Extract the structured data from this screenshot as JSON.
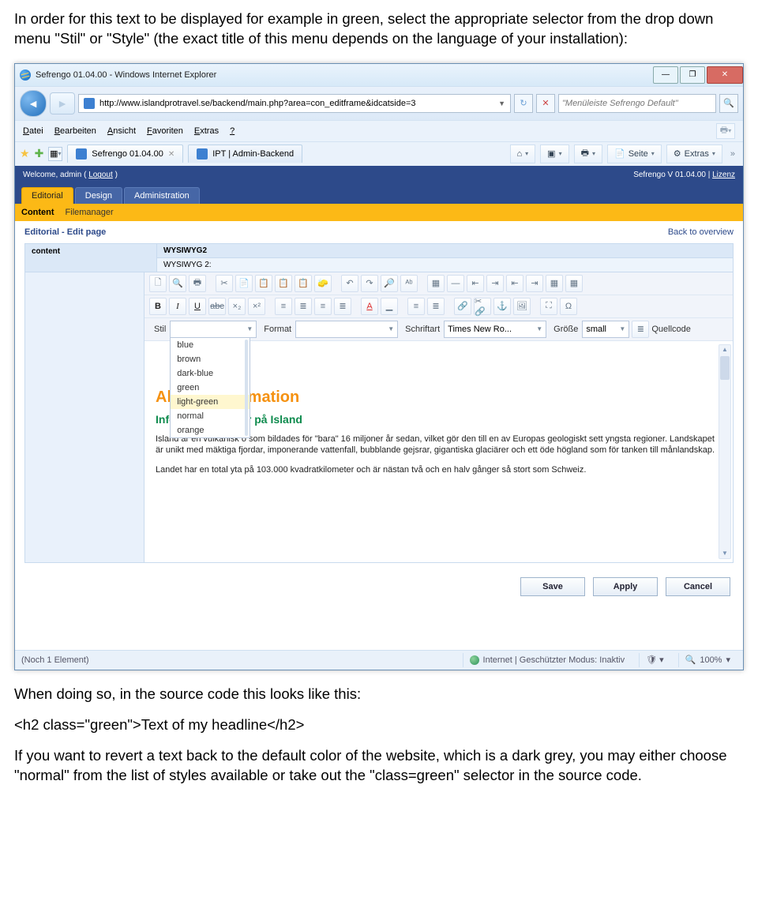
{
  "instructions": {
    "intro": "In order for this text to be displayed for example in green, select the appropriate selector from the drop down menu \"Stil\" or \"Style\" (the exact title of this menu depends on the language of your installation):",
    "source_lead": "When doing so, in the source code this looks like this:",
    "code_example": "<h2 class=\"green\">Text of my headline</h2>",
    "revert": "If you want to revert a text back to the default color of the website, which is a dark grey, you may either choose \"normal\" from the list of styles available or take out the \"class=green\" selector in the source code."
  },
  "browser": {
    "window_title": "Sefrengo 01.04.00 - Windows Internet Explorer",
    "url": "http://www.islandprotravel.se/backend/main.php?area=con_editframe&idcatside=3",
    "search_placeholder": "\"Menüleiste Sefrengo Default\"",
    "menus": [
      "Datei",
      "Bearbeiten",
      "Ansicht",
      "Favoriten",
      "Extras",
      "?"
    ],
    "tabs": [
      {
        "label": "Sefrengo 01.04.00"
      },
      {
        "label": "IPT | Admin-Backend"
      }
    ],
    "righttools": {
      "seite": "Seite",
      "extras": "Extras",
      "chevrons": "»"
    },
    "status": {
      "left": "(Noch 1 Element)",
      "mid": "Internet | Geschützter Modus: Inaktiv",
      "zoom": "100%"
    }
  },
  "app": {
    "welcome": "Welcome, admin (",
    "logout": "Logout",
    "welcome_tail": " )",
    "version": "Sefrengo V 01.04.00 |",
    "license": "Lizenz",
    "main_tabs": [
      "Editorial",
      "Design",
      "Administration"
    ],
    "sub_tabs": [
      "Content",
      "Filemanager"
    ],
    "breadcrumb": "Editorial - Edit page",
    "back": "Back to overview",
    "left_label": "content",
    "wysiwyg_title": "WYSIWYG2",
    "wysiwyg_sub": "WYSIWYG 2:",
    "row3": {
      "stil": "Stil",
      "format": "Format",
      "schriftart_label": "Schriftart",
      "schriftart_value": "Times New Ro...",
      "groesse_label": "Größe",
      "groesse_value": "small",
      "quellcode": "Quellcode"
    },
    "style_options": [
      "blue",
      "brown",
      "dark-blue",
      "green",
      "light-green",
      "normal",
      "orange"
    ],
    "content": {
      "h2": "Allmän information",
      "h3": "Inför din semester på Island",
      "p1": "Island är en vulkanisk ö som bildades för \"bara\" 16 miljoner år sedan, vilket gör den till en av Europas geologiskt sett yngsta regioner. Landskapet är unikt med mäktiga fjordar, imponerande vattenfall, bubblande gejsrar, gigantiska glaciärer och ett öde högland som för tanken till månlandskap.",
      "p2": "Landet har en total yta på 103.000 kvadratkilometer och är nästan två och en halv gånger så stort som Schweiz."
    },
    "buttons": {
      "save": "Save",
      "apply": "Apply",
      "cancel": "Cancel"
    }
  }
}
